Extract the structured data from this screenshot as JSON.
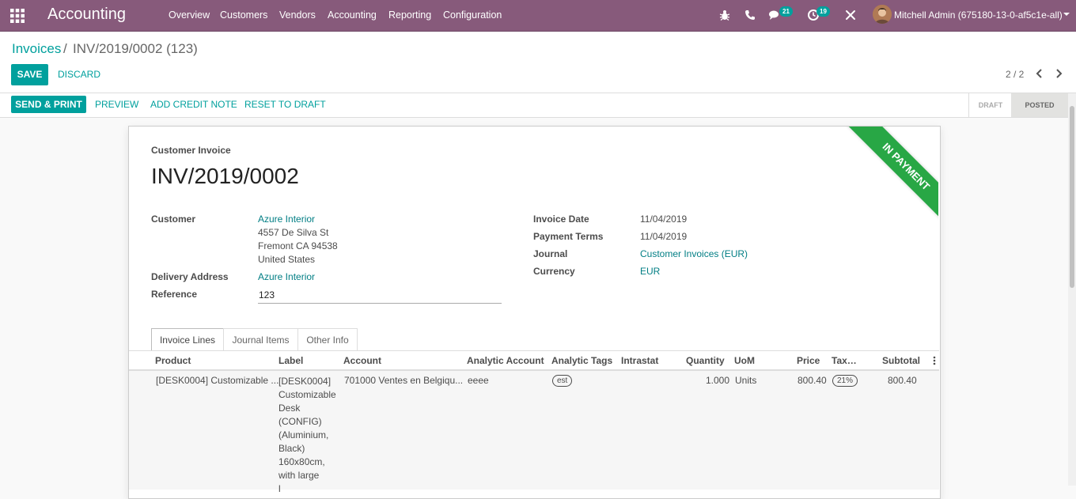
{
  "topbar": {
    "app_name": "Accounting",
    "menu": [
      "Overview",
      "Customers",
      "Vendors",
      "Accounting",
      "Reporting",
      "Configuration"
    ],
    "chat_count": "21",
    "activity_count": "19",
    "user": "Mitchell Admin (675180-13-0-af5c1e-all)"
  },
  "breadcrumb": {
    "parent": "Invoices",
    "separator": "/",
    "current": "INV/2019/0002 (123)"
  },
  "actions": {
    "save": "SAVE",
    "discard": "DISCARD"
  },
  "pager": {
    "text": "2 / 2"
  },
  "statusbar": {
    "buttons": [
      "SEND & PRINT",
      "PREVIEW",
      "ADD CREDIT NOTE",
      "RESET TO DRAFT"
    ],
    "states": [
      "DRAFT",
      "POSTED"
    ],
    "active_state": "POSTED"
  },
  "invoice": {
    "type": "Customer Invoice",
    "number": "INV/2019/0002",
    "ribbon": "IN PAYMENT",
    "customer_label": "Customer",
    "customer": "Azure Interior",
    "address": [
      "4557 De Silva St",
      "Fremont CA 94538",
      "United States"
    ],
    "delivery_label": "Delivery Address",
    "delivery": "Azure Interior",
    "reference_label": "Reference",
    "reference": "123",
    "invoice_date_label": "Invoice Date",
    "invoice_date": "11/04/2019",
    "payment_terms_label": "Payment Terms",
    "payment_terms": "11/04/2019",
    "journal_label": "Journal",
    "journal": "Customer Invoices (EUR)",
    "currency_label": "Currency",
    "currency": "EUR"
  },
  "tabs": [
    "Invoice Lines",
    "Journal Items",
    "Other Info"
  ],
  "table": {
    "headers": [
      "Product",
      "Label",
      "Account",
      "Analytic Account",
      "Analytic Tags",
      "Intrastat",
      "Quantity",
      "UoM",
      "Price",
      "Tax…",
      "Subtotal"
    ],
    "row": {
      "product": "[DESK0004] Customizable ...",
      "label_lines": [
        "[DESK0004]",
        "Customizable",
        "Desk",
        "(CONFIG)",
        "(Aluminium,",
        "Black)",
        "160x80cm,",
        "with large",
        "l"
      ],
      "account": "701000 Ventes en Belgiqu...",
      "analytic_account": "eeee",
      "analytic_tag": "est",
      "quantity": "1.000",
      "uom": "Units",
      "price": "800.40",
      "tax": "21%",
      "subtotal": "800.40"
    }
  },
  "colors": {
    "topbar": "#875a7b",
    "primary": "#00a09d",
    "link": "#017e84",
    "ribbon": "#28a745"
  }
}
